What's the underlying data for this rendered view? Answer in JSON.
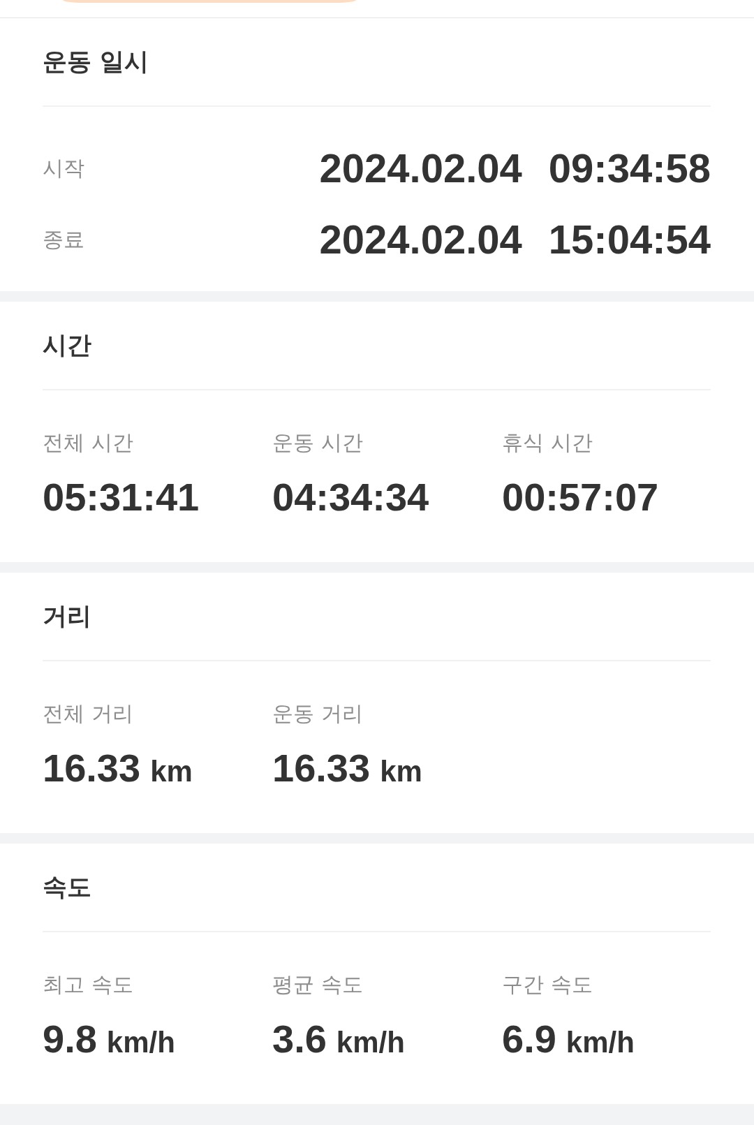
{
  "sections": [
    {
      "kind": "datetime",
      "title": "운동 일시",
      "rows": [
        {
          "label": "시작",
          "date": "2024.02.04",
          "time": "09:34:58"
        },
        {
          "label": "종료",
          "date": "2024.02.04",
          "time": "15:04:54"
        }
      ]
    },
    {
      "kind": "stats",
      "title": "시간",
      "stats": [
        {
          "label": "전체 시간",
          "value": "05:31:41"
        },
        {
          "label": "운동 시간",
          "value": "04:34:34"
        },
        {
          "label": "휴식 시간",
          "value": "00:57:07"
        }
      ]
    },
    {
      "kind": "stats",
      "title": "거리",
      "stats": [
        {
          "label": "전체 거리",
          "value": "16.33",
          "unit": "km"
        },
        {
          "label": "운동 거리",
          "value": "16.33",
          "unit": "km"
        }
      ]
    },
    {
      "kind": "stats",
      "title": "속도",
      "stats": [
        {
          "label": "최고 속도",
          "value": "9.8",
          "unit": "km/h"
        },
        {
          "label": "평균 속도",
          "value": "3.6",
          "unit": "km/h"
        },
        {
          "label": "구간 속도",
          "value": "6.9",
          "unit": "km/h"
        }
      ]
    }
  ]
}
